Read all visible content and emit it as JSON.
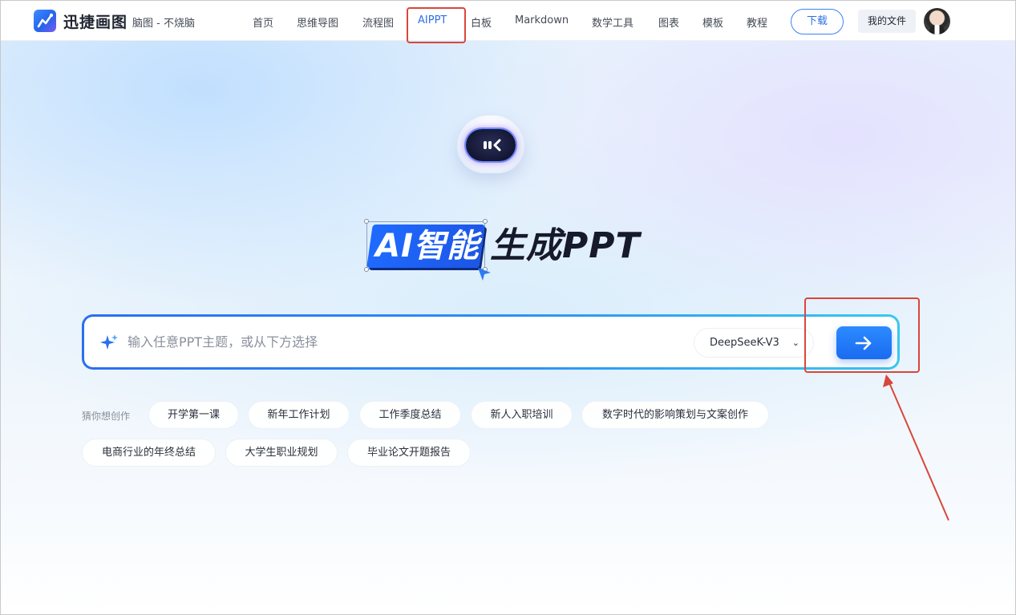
{
  "header": {
    "brand": "迅捷画图",
    "slogan": "脑图 - 不烧脑",
    "nav": [
      "首页",
      "思维导图",
      "流程图",
      "AIPPT",
      "白板",
      "Markdown",
      "数学工具",
      "图表",
      "模板",
      "教程"
    ],
    "active_nav": "AIPPT",
    "download_label": "下载",
    "my_files_label": "我的文件"
  },
  "hero": {
    "title_highlight": "AI智能",
    "title_rest": "生成PPT"
  },
  "search": {
    "placeholder": "输入任意PPT主题，或从下方选择",
    "value": "",
    "model": "DeepSeeK-V3"
  },
  "suggestions": {
    "label": "猜你想创作",
    "row1": [
      "开学第一课",
      "新年工作计划",
      "工作季度总结",
      "新人入职培训",
      "数字时代的影响策划与文案创作"
    ],
    "row2": [
      "电商行业的年终总结",
      "大学生职业规划",
      "毕业论文开题报告"
    ]
  },
  "colors": {
    "accent": "#1f6bff",
    "annotation": "#d9473a"
  }
}
